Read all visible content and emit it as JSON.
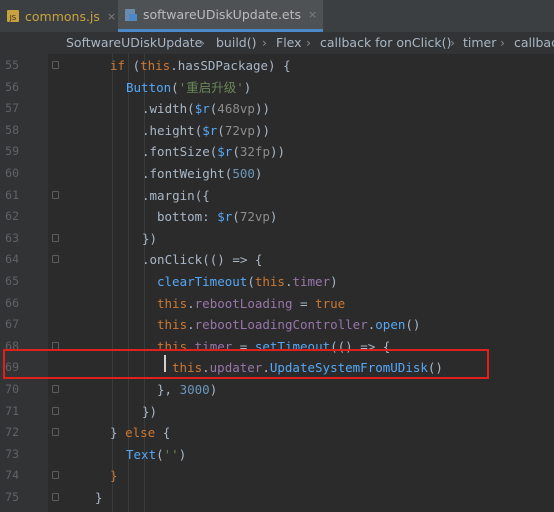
{
  "tabs": [
    {
      "label": "commons.js",
      "icon": "js-file-icon",
      "close": "×"
    },
    {
      "label": "softwareUDiskUpdate.ets",
      "icon": "ets-file-icon",
      "close": "×"
    }
  ],
  "breadcrumb": [
    "SoftwareUDiskUpdate",
    "build()",
    "Flex",
    "callback for onClick()",
    "timer",
    "callbac"
  ],
  "breadcrumb_separator": "›",
  "lines": [
    {
      "num": "55",
      "tokens": [
        {
          "t": "if ",
          "c": "kw"
        },
        {
          "t": "(",
          "c": "plain"
        },
        {
          "t": "this",
          "c": "kw"
        },
        {
          "t": ".hasSDPackage) {",
          "c": "plain"
        }
      ]
    },
    {
      "num": "56",
      "tokens": [
        {
          "t": "Button",
          "c": "fn"
        },
        {
          "t": "(",
          "c": "plain"
        },
        {
          "t": "'重启升级'",
          "c": "str"
        },
        {
          "t": ")",
          "c": "plain"
        }
      ]
    },
    {
      "num": "57",
      "tokens": [
        {
          "t": ".",
          "c": "plain"
        },
        {
          "t": "width",
          "c": "plain"
        },
        {
          "t": "(",
          "c": "plain"
        },
        {
          "t": "$r",
          "c": "fn"
        },
        {
          "t": "(",
          "c": "plain"
        },
        {
          "t": "468vp",
          "c": "hint"
        },
        {
          "t": "))",
          "c": "plain"
        }
      ]
    },
    {
      "num": "58",
      "tokens": [
        {
          "t": ".",
          "c": "plain"
        },
        {
          "t": "height",
          "c": "plain"
        },
        {
          "t": "(",
          "c": "plain"
        },
        {
          "t": "$r",
          "c": "fn"
        },
        {
          "t": "(",
          "c": "plain"
        },
        {
          "t": "72vp",
          "c": "hint"
        },
        {
          "t": "))",
          "c": "plain"
        }
      ]
    },
    {
      "num": "59",
      "tokens": [
        {
          "t": ".",
          "c": "plain"
        },
        {
          "t": "fontSize",
          "c": "plain"
        },
        {
          "t": "(",
          "c": "plain"
        },
        {
          "t": "$r",
          "c": "fn"
        },
        {
          "t": "(",
          "c": "plain"
        },
        {
          "t": "32fp",
          "c": "hint"
        },
        {
          "t": "))",
          "c": "plain"
        }
      ]
    },
    {
      "num": "60",
      "tokens": [
        {
          "t": ".",
          "c": "plain"
        },
        {
          "t": "fontWeight",
          "c": "plain"
        },
        {
          "t": "(",
          "c": "plain"
        },
        {
          "t": "500",
          "c": "num"
        },
        {
          "t": ")",
          "c": "plain"
        }
      ]
    },
    {
      "num": "61",
      "tokens": [
        {
          "t": ".",
          "c": "plain"
        },
        {
          "t": "margin",
          "c": "plain"
        },
        {
          "t": "({",
          "c": "plain"
        }
      ]
    },
    {
      "num": "62",
      "tokens": [
        {
          "t": "bottom: ",
          "c": "plain"
        },
        {
          "t": "$r",
          "c": "fn"
        },
        {
          "t": "(",
          "c": "plain"
        },
        {
          "t": "72vp",
          "c": "hint"
        },
        {
          "t": ")",
          "c": "plain"
        }
      ]
    },
    {
      "num": "63",
      "tokens": [
        {
          "t": "})",
          "c": "plain"
        }
      ]
    },
    {
      "num": "64",
      "tokens": [
        {
          "t": ".onClick",
          "c": "plain"
        },
        {
          "t": "(() => {",
          "c": "plain"
        }
      ]
    },
    {
      "num": "65",
      "tokens": [
        {
          "t": "clearTimeout",
          "c": "fn"
        },
        {
          "t": "(",
          "c": "plain"
        },
        {
          "t": "this",
          "c": "kw"
        },
        {
          "t": ".",
          "c": "plain"
        },
        {
          "t": "timer",
          "c": "mem"
        },
        {
          "t": ")",
          "c": "plain"
        }
      ]
    },
    {
      "num": "66",
      "tokens": [
        {
          "t": "this",
          "c": "kw"
        },
        {
          "t": ".",
          "c": "plain"
        },
        {
          "t": "rebootLoading",
          "c": "mem"
        },
        {
          "t": " = ",
          "c": "plain"
        },
        {
          "t": "true",
          "c": "kw"
        }
      ]
    },
    {
      "num": "67",
      "tokens": [
        {
          "t": "this",
          "c": "kw"
        },
        {
          "t": ".",
          "c": "plain"
        },
        {
          "t": "rebootLoadingController",
          "c": "mem"
        },
        {
          "t": ".",
          "c": "plain"
        },
        {
          "t": "open",
          "c": "fn"
        },
        {
          "t": "()",
          "c": "plain"
        }
      ]
    },
    {
      "num": "68",
      "tokens": [
        {
          "t": "this",
          "c": "kw"
        },
        {
          "t": ".",
          "c": "plain"
        },
        {
          "t": "timer",
          "c": "mem"
        },
        {
          "t": " = ",
          "c": "plain"
        },
        {
          "t": "setTimeout",
          "c": "fn"
        },
        {
          "t": "(() => {",
          "c": "plain"
        }
      ]
    },
    {
      "num": "69",
      "tokens": [
        {
          "t": "this",
          "c": "kw"
        },
        {
          "t": ".",
          "c": "plain"
        },
        {
          "t": "updater",
          "c": "mem"
        },
        {
          "t": ".",
          "c": "plain"
        },
        {
          "t": "UpdateSystemFromUDisk",
          "c": "fn"
        },
        {
          "t": "()",
          "c": "plain"
        }
      ]
    },
    {
      "num": "70",
      "tokens": [
        {
          "t": "}, ",
          "c": "plain"
        },
        {
          "t": "3000",
          "c": "num"
        },
        {
          "t": ")",
          "c": "plain"
        }
      ]
    },
    {
      "num": "71",
      "tokens": [
        {
          "t": "})",
          "c": "plain"
        }
      ]
    },
    {
      "num": "72",
      "tokens": [
        {
          "t": "} ",
          "c": "plain"
        },
        {
          "t": "else",
          "c": "kw"
        },
        {
          "t": " {",
          "c": "plain"
        }
      ]
    },
    {
      "num": "73",
      "tokens": [
        {
          "t": "Text",
          "c": "fn"
        },
        {
          "t": "(",
          "c": "plain"
        },
        {
          "t": "''",
          "c": "str"
        },
        {
          "t": ")",
          "c": "plain"
        }
      ]
    },
    {
      "num": "74",
      "tokens": [
        {
          "t": "}",
          "c": "kw"
        }
      ]
    },
    {
      "num": "75",
      "tokens": [
        {
          "t": "}",
          "c": "plain"
        }
      ]
    }
  ],
  "colors": {
    "editor_bg": "#2b2b2b",
    "highlight_border": "#e0201a",
    "keyword": "#cc7832",
    "function": "#56a8f5",
    "string": "#6a8759",
    "number": "#6897bb",
    "member": "#9876aa"
  }
}
